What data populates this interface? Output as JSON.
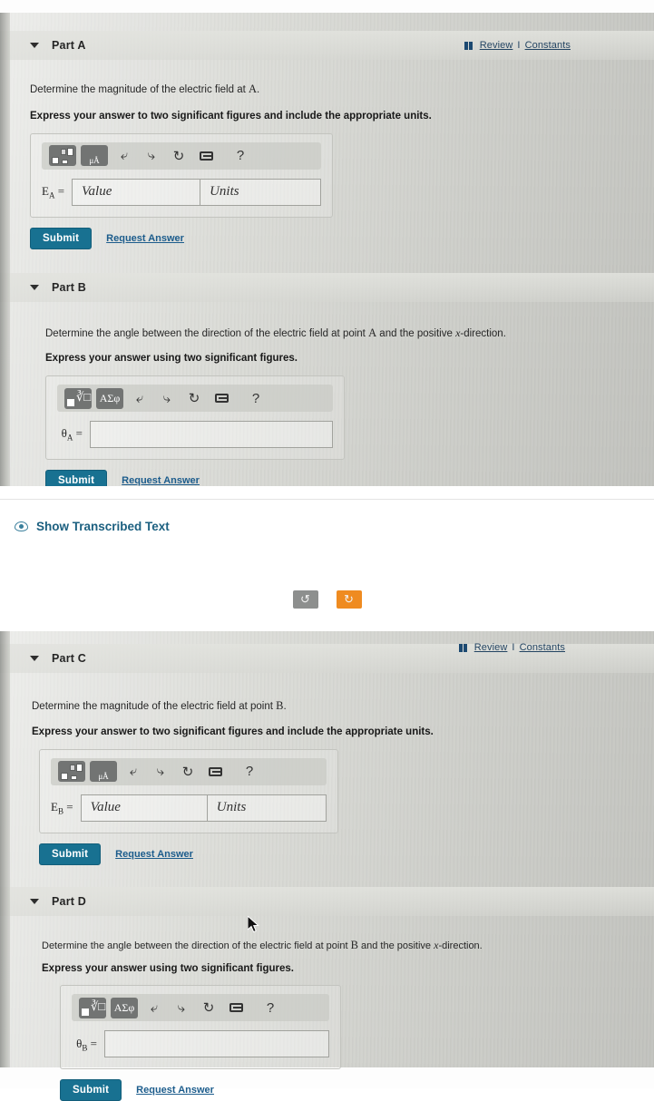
{
  "header": {
    "book_icon": "book-icon",
    "review_label": "Review",
    "separator": "I",
    "constants_label": "Constants"
  },
  "toolbar_icons": {
    "template": "math-template-icon",
    "sqrt": "sqrt-template-icon",
    "units": "units-icon",
    "units_text": "μÅ",
    "greek": "greek-symbols-icon",
    "greek_text": "ΑΣφ",
    "undo": "undo-icon",
    "redo": "redo-icon",
    "reset": "reset-icon",
    "keyboard": "keyboard-icon",
    "help": "?"
  },
  "parts": [
    {
      "id": "part-a",
      "title": "Part A",
      "prompt_pre": "Determine the magnitude of the electric field at ",
      "prompt_var": "A",
      "prompt_post": ".",
      "instruction": "Express your answer to two significant figures and include the appropriate units.",
      "answer_type": "value-units",
      "var_label": "E",
      "var_sub": "A",
      "equals": "=",
      "value_placeholder": "Value",
      "units_placeholder": "Units",
      "value": "",
      "units": "",
      "submit_label": "Submit",
      "request_answer_label": "Request Answer"
    },
    {
      "id": "part-b",
      "title": "Part B",
      "prompt_pre": "Determine the angle between the direction of the electric field at point ",
      "prompt_var": "A",
      "prompt_post": " and the positive x-direction.",
      "instruction": "Express your answer using two significant figures.",
      "answer_type": "single",
      "var_label": "θ",
      "var_sub": "A",
      "equals": "=",
      "value_placeholder": "",
      "value": "",
      "submit_label": "Submit",
      "request_answer_label": "Request Answer"
    },
    {
      "id": "part-c",
      "title": "Part C",
      "prompt_pre": "Determine the magnitude of the electric field at point ",
      "prompt_var": "B",
      "prompt_post": ".",
      "instruction": "Express your answer to two significant figures and include the appropriate units.",
      "answer_type": "value-units",
      "var_label": "E",
      "var_sub": "B",
      "equals": "=",
      "value_placeholder": "Value",
      "units_placeholder": "Units",
      "value": "",
      "units": "",
      "submit_label": "Submit",
      "request_answer_label": "Request Answer"
    },
    {
      "id": "part-d",
      "title": "Part D",
      "prompt_pre": "Determine the angle between the direction of the electric field at point ",
      "prompt_var": "B",
      "prompt_post": " and the positive x-direction.",
      "instruction": "Express your answer using two significant figures.",
      "answer_type": "single",
      "var_label": "θ",
      "var_sub": "B",
      "equals": "=",
      "value_placeholder": "",
      "value": "",
      "submit_label": "Submit",
      "request_answer_label": "Request Answer"
    }
  ],
  "transcribed": {
    "label": "Show Transcribed Text",
    "icon": "eye-icon"
  },
  "mid_buttons": [
    {
      "name": "rotate-left-button",
      "glyph": "↺",
      "color": "#8d8f8e"
    },
    {
      "name": "rotate-right-button",
      "glyph": "↻",
      "color": "#ef8b20"
    }
  ],
  "colors": {
    "submit_bg": "#136e8f",
    "link": "#17598a",
    "accent_orange": "#ef8b20",
    "panel_bg": "#d7d8d3"
  }
}
